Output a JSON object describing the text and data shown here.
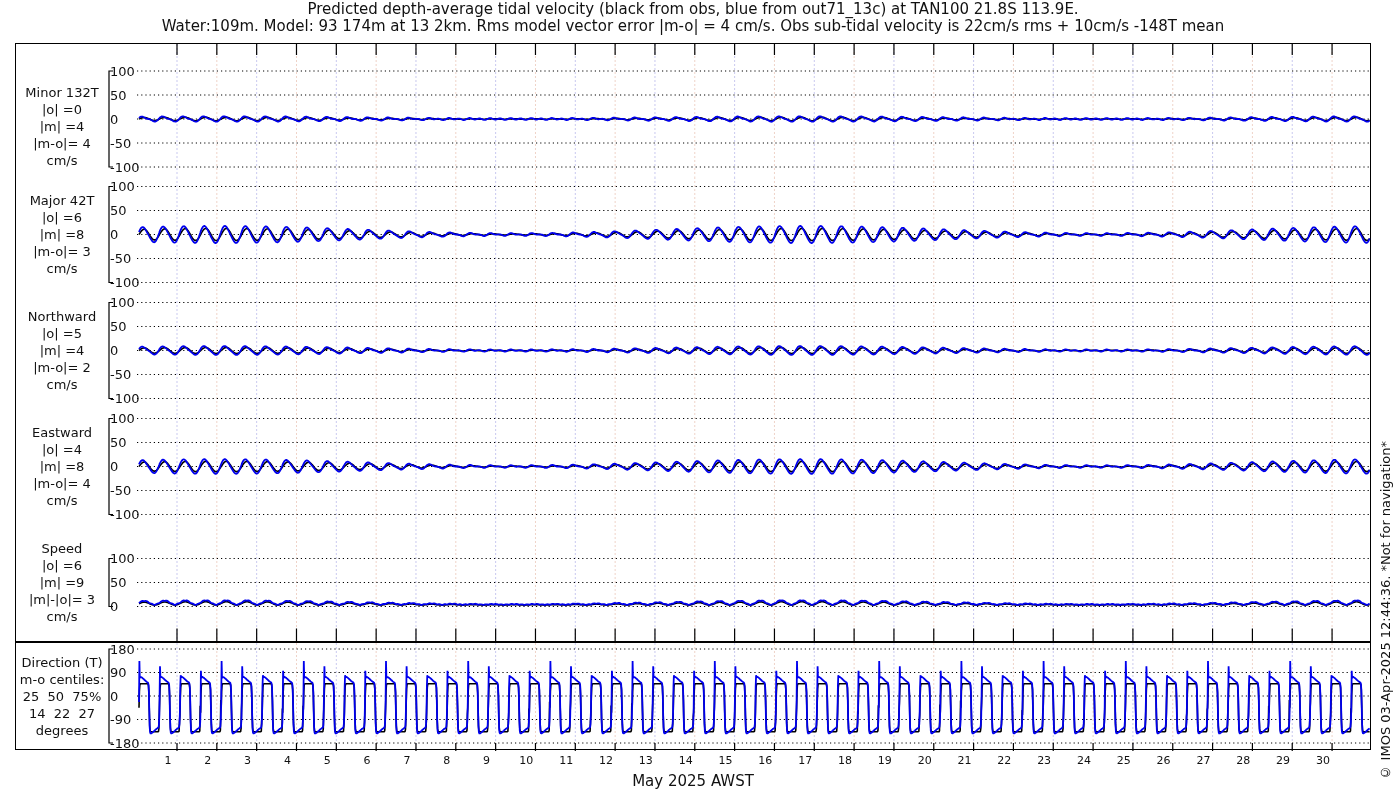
{
  "title_lines": [
    "Predicted depth-average tidal velocity (black from obs, blue from out71_13c) at TAN100 21.8S 113.9E.",
    "Water:109m. Model: 93 174m at 13 2km. Rms model vector error |m-o| = 4 cm/s. Obs sub-tidal velocity is 22cm/s rms + 10cm/s -148T mean"
  ],
  "panels": [
    {
      "kind": "velocity",
      "label_lines": [
        "Minor 132T",
        "|o| =0",
        "|m| =4",
        "|m-o|= 4",
        "cm/s"
      ],
      "yticks": [
        "100",
        "50",
        "0",
        "-50",
        "-100"
      ]
    },
    {
      "kind": "velocity",
      "label_lines": [
        "Major 42T",
        "|o| =6",
        "|m| =8",
        "|m-o|= 3",
        "cm/s"
      ],
      "yticks": [
        "100",
        "50",
        "0",
        "-50",
        "-100"
      ]
    },
    {
      "kind": "velocity",
      "label_lines": [
        "Northward",
        "|o| =5",
        "|m| =4",
        "|m-o|= 2",
        "cm/s"
      ],
      "yticks": [
        "100",
        "50",
        "0",
        "-50",
        "-100"
      ]
    },
    {
      "kind": "velocity",
      "label_lines": [
        "Eastward",
        "|o| =4",
        "|m| =8",
        "|m-o|= 4",
        "cm/s"
      ],
      "yticks": [
        "100",
        "50",
        "0",
        "-50",
        "-100"
      ]
    },
    {
      "kind": "speed",
      "label_lines": [
        "Speed",
        "|o| =6",
        "|m| =9",
        "|m|-|o|= 3",
        "cm/s"
      ],
      "yticks": [
        "100",
        "50",
        "0"
      ]
    },
    {
      "kind": "direction",
      "label_lines": [
        "Direction (T)",
        "m-o centiles:",
        "25  50  75%",
        "14  22  27",
        "degrees"
      ],
      "yticks": [
        "180",
        "90",
        "0",
        "-90",
        "-180"
      ]
    }
  ],
  "x_axis": {
    "days": [
      "1",
      "2",
      "3",
      "4",
      "5",
      "6",
      "7",
      "8",
      "9",
      "10",
      "11",
      "12",
      "13",
      "14",
      "15",
      "16",
      "17",
      "18",
      "19",
      "20",
      "21",
      "22",
      "23",
      "24",
      "25",
      "26",
      "27",
      "28",
      "29",
      "30"
    ],
    "label": "May 2025 AWST"
  },
  "footer_note": "© IMOS 03-Apr-2025 12:44:36. *Not for navigation*"
}
